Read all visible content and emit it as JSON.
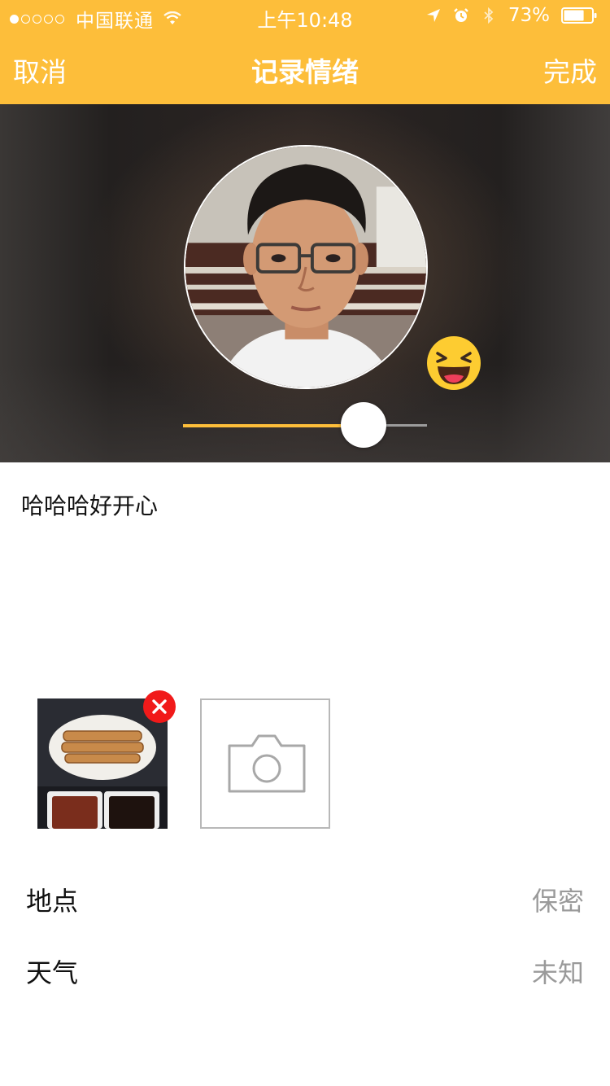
{
  "status_bar": {
    "carrier": "中国联通",
    "time": "上午10:48",
    "battery_percent": "73%",
    "battery_level": 0.73,
    "signal_strength": 1,
    "signal_total": 5,
    "icons": [
      "wifi-icon",
      "location-arrow-icon",
      "alarm-icon",
      "bluetooth-icon",
      "battery-icon"
    ]
  },
  "nav": {
    "cancel_label": "取消",
    "title": "记录情绪",
    "done_label": "完成"
  },
  "hero": {
    "photo": "face-avatar",
    "emoji": "laughing-squint-emoji",
    "slider_value": 0.74,
    "slider_color": "#FDBE3A"
  },
  "note": {
    "text": "哈哈哈好开心"
  },
  "photos": {
    "items": [
      {
        "subject": "dumplings-plate-photo"
      }
    ],
    "add_icon": "camera-icon"
  },
  "info": [
    {
      "label": "地点",
      "value": "保密"
    },
    {
      "label": "天气",
      "value": "未知"
    }
  ],
  "colors": {
    "accent": "#FDBE3A",
    "remove": "#F11A1A",
    "muted_text": "#9A9A9A"
  }
}
